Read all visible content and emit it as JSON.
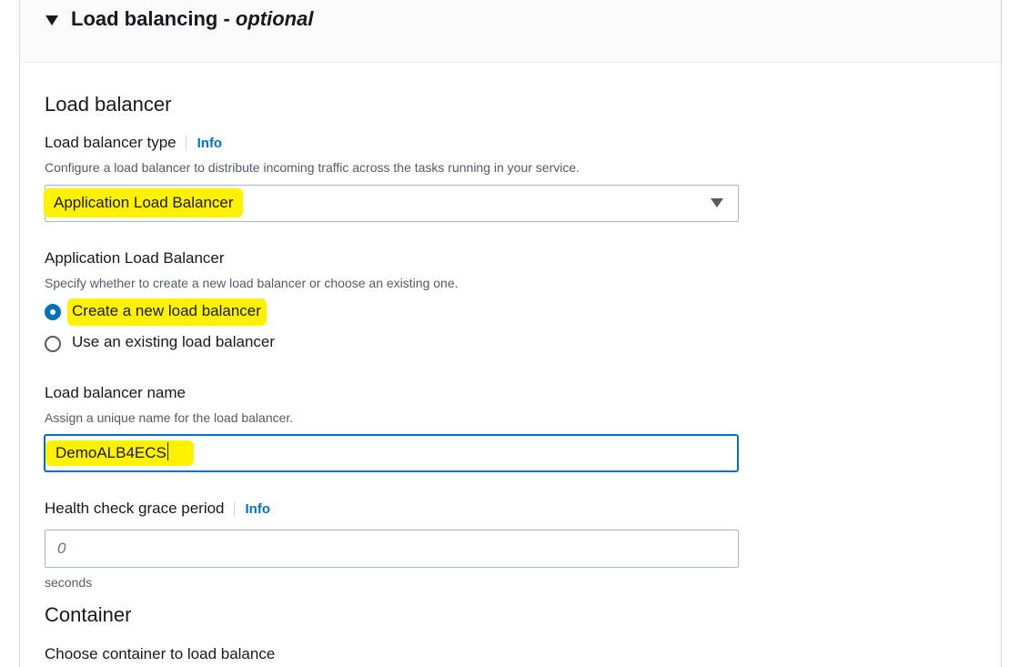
{
  "section": {
    "title": "Load balancing - ",
    "title_optional": "optional"
  },
  "load_balancer": {
    "heading": "Load balancer",
    "type_label": "Load balancer type",
    "type_info": "Info",
    "type_description": "Configure a load balancer to distribute incoming traffic across the tasks running in your service.",
    "type_selected": "Application Load Balancer"
  },
  "alb": {
    "label": "Application Load Balancer",
    "description": "Specify whether to create a new load balancer or choose an existing one.",
    "options": [
      {
        "label": "Create a new load balancer",
        "checked": true
      },
      {
        "label": "Use an existing load balancer",
        "checked": false
      }
    ]
  },
  "lb_name": {
    "label": "Load balancer name",
    "description": "Assign a unique name for the load balancer.",
    "value": "DemoALB4ECS"
  },
  "health_check": {
    "label": "Health check grace period",
    "info": "Info",
    "placeholder": "0",
    "unit": "seconds"
  },
  "container": {
    "heading": "Container",
    "label": "Choose container to load balance"
  },
  "colors": {
    "highlight": "#fff200",
    "link": "#0073bb",
    "focus_border": "#0073bb"
  }
}
